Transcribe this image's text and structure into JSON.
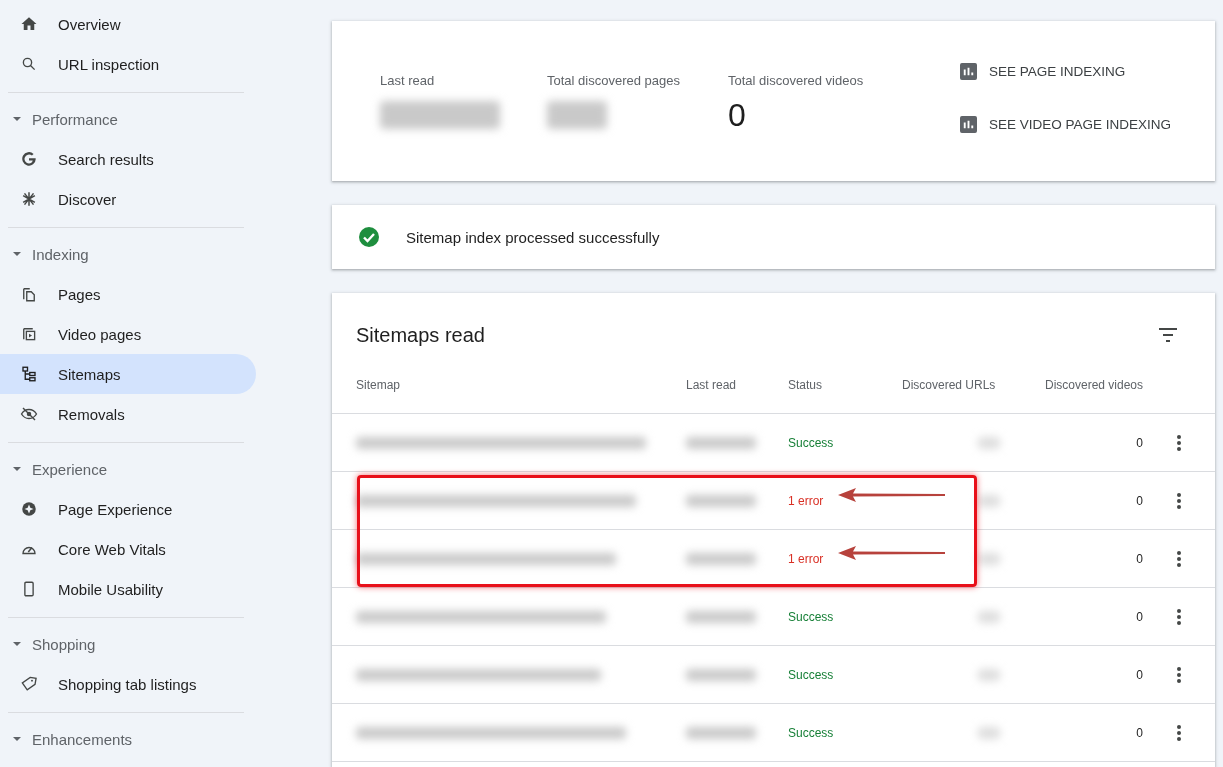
{
  "sidebar": {
    "groups": [
      {
        "items": [
          {
            "label": "Overview",
            "selected": false
          },
          {
            "label": "URL inspection",
            "selected": false
          }
        ]
      },
      {
        "title": "Performance",
        "expanded": true,
        "items": [
          {
            "label": "Search results",
            "selected": false
          },
          {
            "label": "Discover",
            "selected": false
          }
        ]
      },
      {
        "title": "Indexing",
        "expanded": true,
        "items": [
          {
            "label": "Pages",
            "selected": false
          },
          {
            "label": "Video pages",
            "selected": false
          },
          {
            "label": "Sitemaps",
            "selected": true
          },
          {
            "label": "Removals",
            "selected": false
          }
        ]
      },
      {
        "title": "Experience",
        "expanded": true,
        "items": [
          {
            "label": "Page Experience",
            "selected": false
          },
          {
            "label": "Core Web Vitals",
            "selected": false
          },
          {
            "label": "Mobile Usability",
            "selected": false
          }
        ]
      },
      {
        "title": "Shopping",
        "expanded": true,
        "items": [
          {
            "label": "Shopping tab listings",
            "selected": false
          }
        ]
      },
      {
        "title": "Enhancements",
        "expanded": true
      }
    ]
  },
  "summary": {
    "stats": [
      {
        "label": "Last read",
        "kind": "blurred"
      },
      {
        "label": "Total discovered pages",
        "kind": "blurred"
      },
      {
        "label": "Total discovered videos",
        "kind": "value",
        "value": "0"
      }
    ],
    "links": [
      "SEE PAGE INDEXING",
      "SEE VIDEO PAGE INDEXING"
    ]
  },
  "status_card": {
    "message": "Sitemap index processed successfully"
  },
  "table": {
    "title": "Sitemaps read",
    "columns": [
      "Sitemap",
      "Last read",
      "Status",
      "Discovered URLs",
      "Discovered videos"
    ],
    "rows": [
      {
        "status": "Success",
        "kind": "success",
        "videos": "0",
        "highlighted": false
      },
      {
        "status": "1 error",
        "kind": "error",
        "videos": "0",
        "highlighted": true
      },
      {
        "status": "1 error",
        "kind": "error",
        "videos": "0",
        "highlighted": true
      },
      {
        "status": "Success",
        "kind": "success",
        "videos": "0",
        "highlighted": false
      },
      {
        "status": "Success",
        "kind": "success",
        "videos": "0",
        "highlighted": false
      },
      {
        "status": "Success",
        "kind": "success",
        "videos": "0",
        "highlighted": false
      }
    ]
  }
}
